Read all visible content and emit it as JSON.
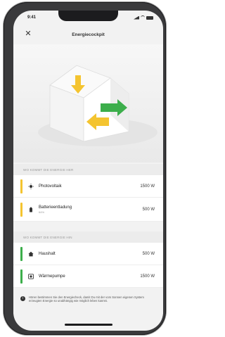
{
  "status": {
    "time": "9:41"
  },
  "header": {
    "title": "Energiecockpit",
    "close_icon": "close-icon"
  },
  "sources": {
    "heading": "WO KOMMT DIE ENERGIE HER",
    "items": [
      {
        "label": "Photovoltaik",
        "sub": "",
        "value": "1500 W",
        "color": "#f4c430",
        "icon": "sun-icon"
      },
      {
        "label": "Batterieentladung",
        "sub": "64%",
        "value": "500 W",
        "color": "#f4c430",
        "icon": "battery-icon"
      }
    ]
  },
  "consumers": {
    "heading": "WO KOMMT DIE ENERGIE HIN",
    "items": [
      {
        "label": "Haushalt",
        "value": "500 W",
        "color": "#3cae4b",
        "icon": "house-icon"
      },
      {
        "label": "Wärmepumpe",
        "value": "1500 W",
        "color": "#3cae4b",
        "icon": "heatpump-icon"
      }
    ]
  },
  "info": {
    "text": "Hören bestimmen Sie den Energiecheck, damit Du mit der vom Sonnen eigenen System erzeugten Energie so unabhängig wie möglich leben kannst."
  },
  "colors": {
    "yellow": "#f4c430",
    "green": "#3cae4b"
  }
}
